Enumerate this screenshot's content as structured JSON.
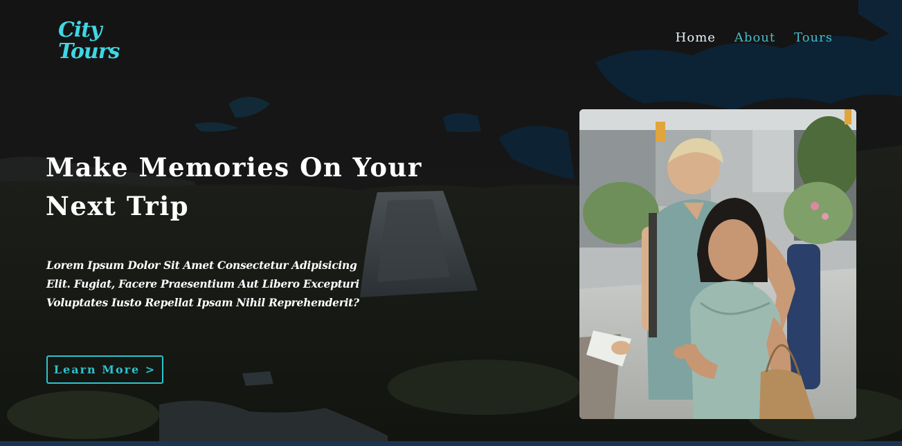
{
  "header": {
    "logo": {
      "line1": "City",
      "line2": "Tours"
    },
    "nav": [
      {
        "label": "Home",
        "active": true
      },
      {
        "label": "About",
        "active": false
      },
      {
        "label": "Tours",
        "active": false
      }
    ]
  },
  "hero": {
    "headline_line1": "Make Memories On Your",
    "headline_line2": "Next Trip",
    "lede": "Lorem Ipsum Dolor Sit Amet Consectetur Adipisicing Elit. Fugiat, Facere Praesentium Aut Libero Excepturi Voluptates Iusto Repellat Ipsam Nihil Reprehenderit?",
    "cta_label": "Learn More >",
    "photo_alt": "couple-of-tourists-photo"
  },
  "colors": {
    "accent": "#2cc4cc",
    "logo": "#3fd7e4",
    "nav_link": "#45bcc6",
    "nav_active": "#e6f3f6",
    "overlay": "#101010"
  }
}
